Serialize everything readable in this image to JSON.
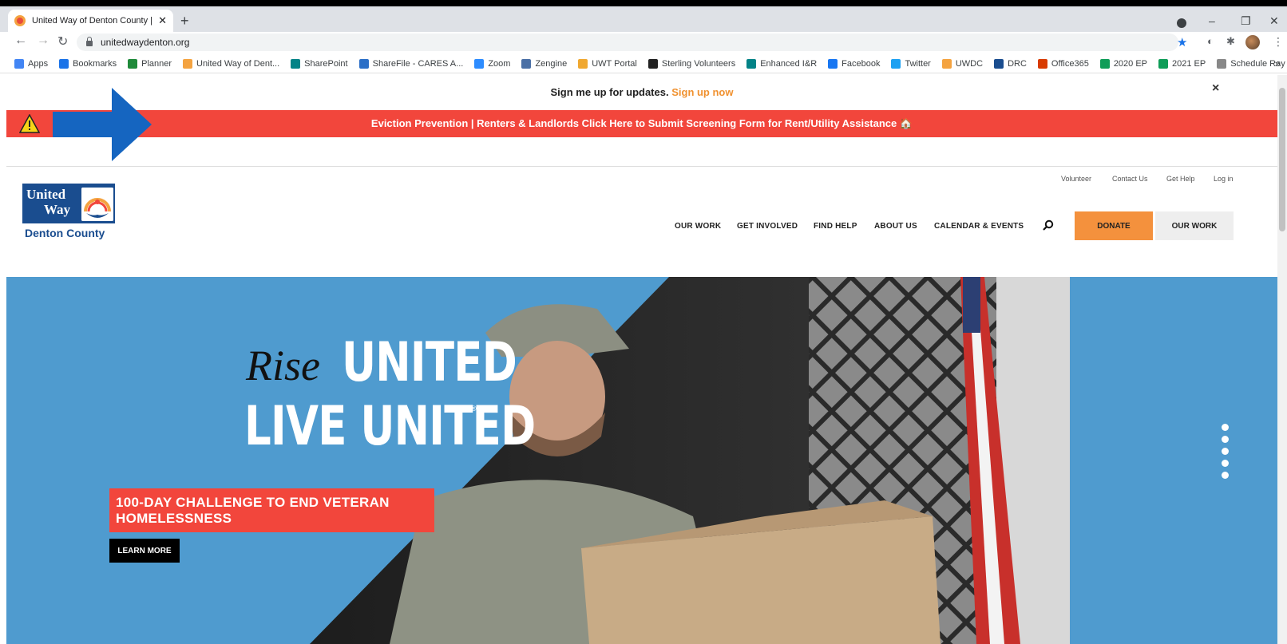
{
  "browser": {
    "tab_title": "United Way of Denton County |",
    "url": "unitedwaydenton.org",
    "bookmarks": [
      {
        "label": "Apps",
        "color": "#4285f4"
      },
      {
        "label": "Bookmarks",
        "color": "#1a73e8"
      },
      {
        "label": "Planner",
        "color": "#1f8a3a"
      },
      {
        "label": "United Way of Dent...",
        "color": "#f4a340"
      },
      {
        "label": "SharePoint",
        "color": "#038387"
      },
      {
        "label": "ShareFile - CARES A...",
        "color": "#2b6fc7"
      },
      {
        "label": "Zoom",
        "color": "#2d8cff"
      },
      {
        "label": "Zengine",
        "color": "#4a6fa5"
      },
      {
        "label": "UWT Portal",
        "color": "#f0a830"
      },
      {
        "label": "Sterling Volunteers",
        "color": "#222222"
      },
      {
        "label": "Enhanced I&R",
        "color": "#038387"
      },
      {
        "label": "Facebook",
        "color": "#1877f2"
      },
      {
        "label": "Twitter",
        "color": "#1da1f2"
      },
      {
        "label": "UWDC",
        "color": "#f4a340"
      },
      {
        "label": "DRC",
        "color": "#1a4d8f"
      },
      {
        "label": "Office365",
        "color": "#d83b01"
      },
      {
        "label": "2020 EP",
        "color": "#0f9d58"
      },
      {
        "label": "2021 EP",
        "color": "#0f9d58"
      },
      {
        "label": "Schedule Ray Croff",
        "color": "#888888"
      }
    ],
    "more": "»"
  },
  "announcement": {
    "text": "Sign me up for updates.",
    "link": "Sign up now",
    "close": "×"
  },
  "alert": {
    "text": "Eviction Prevention | Renters & Landlords Click Here to Submit Screening Form for Rent/Utility Assistance 🏠",
    "color": "#f2463c"
  },
  "logo": {
    "line1": "United",
    "line2": "Way",
    "subtitle": "Denton County"
  },
  "utility_nav": [
    "Volunteer",
    "Contact Us",
    "Get Help",
    "Log in"
  ],
  "main_nav": [
    "OUR WORK",
    "GET INVOLVED",
    "FIND HELP",
    "ABOUT US",
    "CALENDAR & EVENTS"
  ],
  "buttons": {
    "donate": "DONATE",
    "our_work": "OUR WORK"
  },
  "hero": {
    "rise": "Rise",
    "united": "UNITED",
    "live_united": "LIVE UNITED",
    "reg": "®",
    "callout": "100-DAY CHALLENGE TO END VETERAN HOMELESSNESS",
    "cta": "LEARN MORE",
    "slides": 5
  }
}
